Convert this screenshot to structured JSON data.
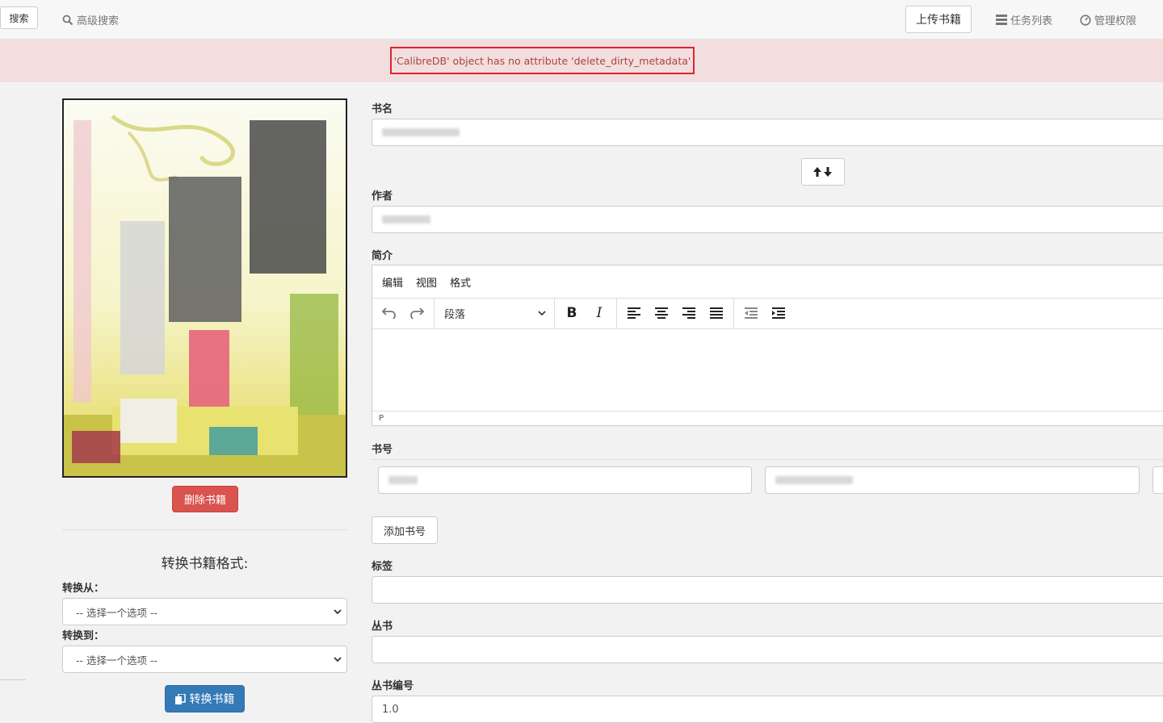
{
  "topbar": {
    "search_button": "搜索",
    "advanced_search": "高级搜索",
    "upload_button": "上传书籍",
    "tasks": "任务列表",
    "admin": "管理权限"
  },
  "alert": {
    "message": "'CalibreDB' object has no attribute 'delete_dirty_metadata'"
  },
  "left": {
    "delete_button": "删除书籍",
    "convert_heading": "转换书籍格式:",
    "convert_from_label": "转换从：",
    "convert_to_label": "转换到：",
    "select_placeholder": "-- 选择一个选项 --",
    "convert_button": "转换书籍"
  },
  "form": {
    "title_label": "书名",
    "author_label": "作者",
    "description_label": "简介",
    "identifiers_label": "书号",
    "add_identifier_button": "添加书号",
    "tags_label": "标签",
    "series_label": "丛书",
    "series_index_label": "丛书编号",
    "series_index_value": "1.0"
  },
  "editor": {
    "menus": [
      "编辑",
      "视图",
      "格式"
    ],
    "block_format": "段落",
    "status_path": "P"
  },
  "icons": {
    "search": "search-icon",
    "tasks": "list-icon",
    "admin": "dashboard-icon",
    "swap": "swap-arrows-icon",
    "convert": "copy-icon"
  },
  "colors": {
    "alert_bg": "#f2dede",
    "alert_highlight": "#e0242b",
    "danger": "#d9534f",
    "primary": "#337ab7"
  }
}
